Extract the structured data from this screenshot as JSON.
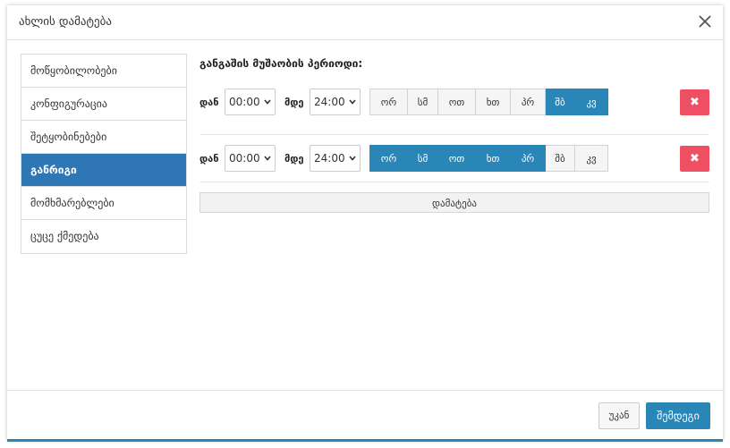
{
  "modal": {
    "title": "ახლის დამატება",
    "close_icon": "close-icon"
  },
  "sidebar": {
    "items": [
      {
        "label": "მოწყობილობები",
        "active": false
      },
      {
        "label": "კონფიგურაცია",
        "active": false
      },
      {
        "label": "შეტყობინებები",
        "active": false
      },
      {
        "label": "განრიგი",
        "active": true
      },
      {
        "label": "მომხმარებლები",
        "active": false
      },
      {
        "label": "ცუცე ქმედება",
        "active": false
      }
    ]
  },
  "schedule": {
    "section_title": "განგაშის მუშაობის პერიოდი:",
    "from_label": "დან",
    "to_label": "მდე",
    "rows": [
      {
        "from": "00:00",
        "to": "24:00",
        "days": [
          {
            "label": "ორ",
            "on": false
          },
          {
            "label": "სმ",
            "on": false
          },
          {
            "label": "ოთ",
            "on": false
          },
          {
            "label": "ხთ",
            "on": false
          },
          {
            "label": "პრ",
            "on": false
          },
          {
            "label": "შბ",
            "on": true
          },
          {
            "label": "კვ",
            "on": true
          }
        ],
        "remove_icon": "remove-icon"
      },
      {
        "from": "00:00",
        "to": "24:00",
        "days": [
          {
            "label": "ორ",
            "on": true
          },
          {
            "label": "სმ",
            "on": true
          },
          {
            "label": "ოთ",
            "on": true
          },
          {
            "label": "ხთ",
            "on": true
          },
          {
            "label": "პრ",
            "on": true
          },
          {
            "label": "შბ",
            "on": false
          },
          {
            "label": "კვ",
            "on": false
          }
        ],
        "remove_icon": "remove-icon"
      }
    ],
    "add_label": "დამატება"
  },
  "footer": {
    "back_label": "უკან",
    "next_label": "შემდეგი"
  },
  "colors": {
    "accent": "#2a86b6",
    "sidebar_active": "#2e76b4",
    "danger": "#ee4f63"
  }
}
